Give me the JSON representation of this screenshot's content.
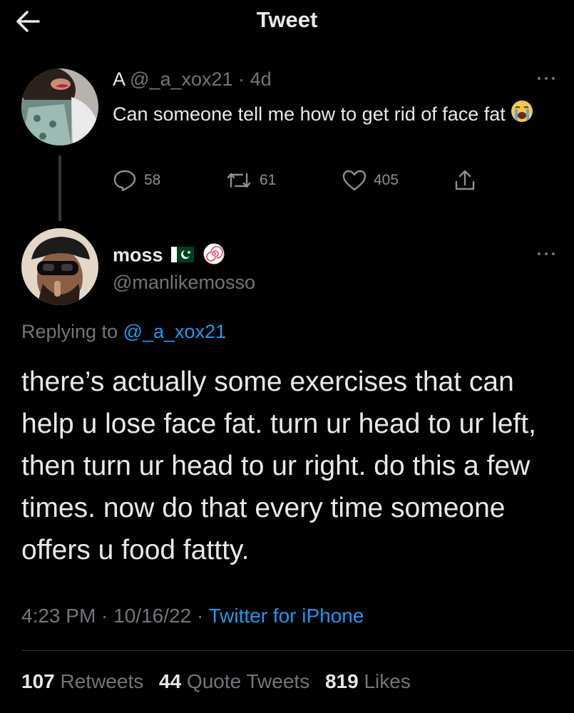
{
  "header": {
    "title": "Tweet"
  },
  "original": {
    "name": "A",
    "handle": "@_a_xox21",
    "separator": " · ",
    "time": "4d",
    "text": "Can someone tell me how to get rid of face fat",
    "emoji": "loudly-crying-face",
    "replies": "58",
    "retweets": "61",
    "likes": "405"
  },
  "reply": {
    "name": "moss",
    "handle": "@manlikemosso",
    "replying_prefix": "Replying to ",
    "replying_to": "@_a_xox21",
    "text": "there’s actually some exercises that can help u lose face fat. turn ur head to ur left, then turn ur head to ur right. do this a few times. now do that every time someone offers u food fattty.",
    "time": "4:23 PM",
    "date": "10/16/22",
    "dot": " · ",
    "source": "Twitter for iPhone"
  },
  "stats": [
    {
      "count": "107",
      "label": "Retweets"
    },
    {
      "count": "44",
      "label": "Quote Tweets"
    },
    {
      "count": "819",
      "label": "Likes"
    }
  ],
  "colors": {
    "background": "#000000",
    "text": "#e7e9ea",
    "muted": "#71767b",
    "link": "#1d9bf0"
  }
}
